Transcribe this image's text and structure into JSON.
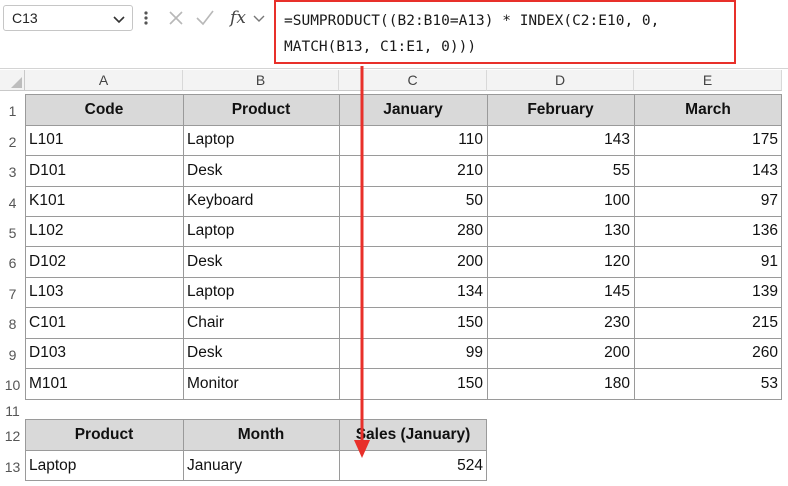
{
  "formula_bar": {
    "name_box": "C13",
    "formula_line1": "=SUMPRODUCT((B2:B10=A13) * INDEX(C2:E10, 0,",
    "formula_line2": "MATCH(B13, C1:E1, 0)))"
  },
  "columns": [
    "A",
    "B",
    "C",
    "D",
    "E"
  ],
  "rows": [
    "1",
    "2",
    "3",
    "4",
    "5",
    "6",
    "7",
    "8",
    "9",
    "10",
    "11",
    "12",
    "13"
  ],
  "table1": {
    "headers": [
      "Code",
      "Product",
      "January",
      "February",
      "March"
    ],
    "rows": [
      [
        "L101",
        "Laptop",
        "110",
        "143",
        "175"
      ],
      [
        "D101",
        "Desk",
        "210",
        "55",
        "143"
      ],
      [
        "K101",
        "Keyboard",
        "50",
        "100",
        "97"
      ],
      [
        "L102",
        "Laptop",
        "280",
        "130",
        "136"
      ],
      [
        "D102",
        "Desk",
        "200",
        "120",
        "91"
      ],
      [
        "L103",
        "Laptop",
        "134",
        "145",
        "139"
      ],
      [
        "C101",
        "Chair",
        "150",
        "230",
        "215"
      ],
      [
        "D103",
        "Desk",
        "99",
        "200",
        "260"
      ],
      [
        "M101",
        "Monitor",
        "150",
        "180",
        "53"
      ]
    ]
  },
  "table2": {
    "headers": [
      "Product",
      "Month",
      "Sales (January)"
    ],
    "row": [
      "Laptop",
      "January",
      "524"
    ]
  },
  "colors": {
    "highlight": "#e8302a",
    "header_fill": "#d9d9d9"
  }
}
